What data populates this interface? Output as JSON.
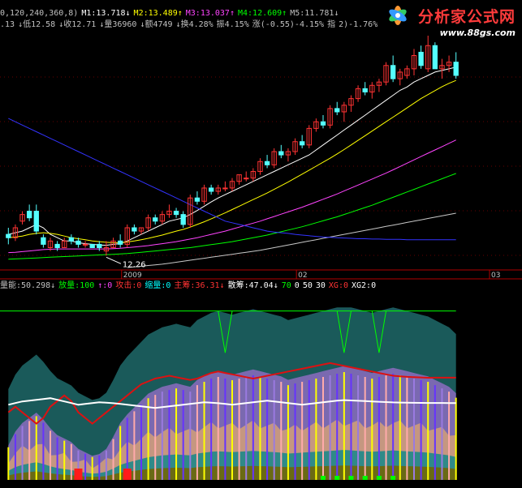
{
  "header": {
    "line1": [
      {
        "text": "0,120,240,360,8)",
        "color": "#c0c0c0"
      },
      {
        "text": "M1:13.718↓",
        "color": "#ffffff"
      },
      {
        "text": "M2:13.489↑",
        "color": "#ffff00"
      },
      {
        "text": "M3:13.037↑",
        "color": "#ff44ff"
      },
      {
        "text": "M4:12.609↑",
        "color": "#00ff00"
      },
      {
        "text": "M5:11.781↓",
        "color": "#c0c0c0"
      }
    ],
    "line2": [
      {
        "text": ".13",
        "color": "#c0c0c0"
      },
      {
        "text": "↓低12.58",
        "color": "#c0c0c0"
      },
      {
        "text": "↓收12.71",
        "color": "#c0c0c0"
      },
      {
        "text": "↓量36960",
        "color": "#c0c0c0"
      },
      {
        "text": "↓额4749",
        "color": "#c0c0c0"
      },
      {
        "text": "↓换4.28%",
        "color": "#c0c0c0"
      },
      {
        "text": "振4.15%",
        "color": "#c0c0c0"
      },
      {
        "text": "涨(-0.55)-4.15%",
        "color": "#c0c0c0"
      },
      {
        "text": "指",
        "color": "#c0c0c0"
      },
      {
        "text": "2)-1.76%",
        "color": "#c0c0c0"
      }
    ],
    "indicator_line": [
      {
        "text": "量能:50.298↓",
        "color": "#c0c0c0"
      },
      {
        "text": "放量:100",
        "color": "#00ff00"
      },
      {
        "text": "↑:0",
        "color": "#ff44ff"
      },
      {
        "text": "攻击:0",
        "color": "#ff3333"
      },
      {
        "text": "缩量:0",
        "color": "#00ffff"
      },
      {
        "text": "主筹:36.31↓",
        "color": "#ff3333"
      },
      {
        "text": "散筹:47.04↓",
        "color": "#ffffff"
      },
      {
        "text": "70",
        "color": "#00ff00"
      },
      {
        "text": "0",
        "color": "#ffffff"
      },
      {
        "text": "50",
        "color": "#ffffff"
      },
      {
        "text": "30",
        "color": "#ffffff"
      },
      {
        "text": "XG:0",
        "color": "#ff3333"
      },
      {
        "text": "XG2:0",
        "color": "#ffffff"
      }
    ]
  },
  "watermark": {
    "title": "分析家公式网",
    "url": "www.88gs.com"
  },
  "colors": {
    "up": "#ff3333",
    "down": "#54ffff",
    "ma1": "#ffffff",
    "ma2": "#ffff00",
    "ma3": "#ff44ff",
    "ma4": "#00ff00",
    "ma5": "#c8c8c8",
    "ma_long": "#3333ff",
    "axis": "#b00000",
    "grid": "#660000",
    "area_dark": "#1a5a5a",
    "area_purple": "#8c6cc0",
    "area_olive": "#6a6a14",
    "area_tan": "#d2a078",
    "area_teal": "#1e8888"
  },
  "chart_data": [
    {
      "type": "candlestick",
      "x_labels": [
        "2009",
        "02",
        "03"
      ],
      "annotations": [
        {
          "text": "12.26",
          "bar": 14
        }
      ],
      "ohlc": [
        [
          12.9,
          13.1,
          12.6,
          12.8
        ],
        [
          12.8,
          13.2,
          12.7,
          13.1
        ],
        [
          13.3,
          13.6,
          13.2,
          13.5
        ],
        [
          13.6,
          13.8,
          13.3,
          13.4
        ],
        [
          13.6,
          13.8,
          12.9,
          13.0
        ],
        [
          12.8,
          12.9,
          12.5,
          12.6
        ],
        [
          12.5,
          12.8,
          12.4,
          12.7
        ],
        [
          12.6,
          12.7,
          12.4,
          12.5
        ],
        [
          12.5,
          12.8,
          12.5,
          12.7
        ],
        [
          12.8,
          12.9,
          12.6,
          12.7
        ],
        [
          12.7,
          12.8,
          12.5,
          12.6
        ],
        [
          12.6,
          12.7,
          12.5,
          12.6
        ],
        [
          12.6,
          12.6,
          12.5,
          12.5
        ],
        [
          12.6,
          12.7,
          12.4,
          12.5
        ],
        [
          12.4,
          12.7,
          12.26,
          12.5
        ],
        [
          12.5,
          12.8,
          12.5,
          12.7
        ],
        [
          12.7,
          12.9,
          12.5,
          12.6
        ],
        [
          12.6,
          13.2,
          12.5,
          13.1
        ],
        [
          13.1,
          13.2,
          12.9,
          13.0
        ],
        [
          13.0,
          13.1,
          12.9,
          13.1
        ],
        [
          13.1,
          13.5,
          13.0,
          13.4
        ],
        [
          13.4,
          13.5,
          13.2,
          13.3
        ],
        [
          13.3,
          13.6,
          13.2,
          13.5
        ],
        [
          13.5,
          13.8,
          13.4,
          13.6
        ],
        [
          13.6,
          13.7,
          13.4,
          13.5
        ],
        [
          13.5,
          13.6,
          13.1,
          13.2
        ],
        [
          13.2,
          14.1,
          13.1,
          14.0
        ],
        [
          14.0,
          14.2,
          13.8,
          13.9
        ],
        [
          13.9,
          14.4,
          13.8,
          14.3
        ],
        [
          14.3,
          14.4,
          14.1,
          14.2
        ],
        [
          14.2,
          14.4,
          14.1,
          14.3
        ],
        [
          14.3,
          14.5,
          14.2,
          14.3
        ],
        [
          14.3,
          14.6,
          14.2,
          14.5
        ],
        [
          14.5,
          14.7,
          14.4,
          14.7
        ],
        [
          14.6,
          14.8,
          14.5,
          14.6
        ],
        [
          14.6,
          14.9,
          14.5,
          14.8
        ],
        [
          14.8,
          15.2,
          14.7,
          15.1
        ],
        [
          15.1,
          15.3,
          14.9,
          15.0
        ],
        [
          15.0,
          15.5,
          14.9,
          15.4
        ],
        [
          15.4,
          15.6,
          15.2,
          15.3
        ],
        [
          15.3,
          15.5,
          15.1,
          15.4
        ],
        [
          15.4,
          15.8,
          15.3,
          15.7
        ],
        [
          15.7,
          15.9,
          15.5,
          15.6
        ],
        [
          15.6,
          16.2,
          15.5,
          16.1
        ],
        [
          16.1,
          16.4,
          16.0,
          16.3
        ],
        [
          16.3,
          16.5,
          16.1,
          16.2
        ],
        [
          16.2,
          16.8,
          16.1,
          16.7
        ],
        [
          16.7,
          16.9,
          16.5,
          16.6
        ],
        [
          16.6,
          16.9,
          16.3,
          16.8
        ],
        [
          16.8,
          17.1,
          16.6,
          17.0
        ],
        [
          17.0,
          17.4,
          16.9,
          17.3
        ],
        [
          17.3,
          17.5,
          17.1,
          17.2
        ],
        [
          17.2,
          17.5,
          17.0,
          17.4
        ],
        [
          17.4,
          17.6,
          17.2,
          17.5
        ],
        [
          17.5,
          18.1,
          17.4,
          18.0
        ],
        [
          18.0,
          18.3,
          17.5,
          17.6
        ],
        [
          17.6,
          17.9,
          17.4,
          17.8
        ],
        [
          17.7,
          18.0,
          17.6,
          17.9
        ],
        [
          17.9,
          18.5,
          17.7,
          18.3
        ],
        [
          18.4,
          18.6,
          17.9,
          18.0
        ],
        [
          17.9,
          18.9,
          17.8,
          18.6
        ],
        [
          18.6,
          18.7,
          18.0,
          17.9
        ],
        [
          17.9,
          18.2,
          17.6,
          18.0
        ],
        [
          18.0,
          18.3,
          17.8,
          18.1
        ],
        [
          18.1,
          18.4,
          17.6,
          17.7
        ]
      ],
      "ma_lines": {
        "M1": [
          12.9,
          12.95,
          13.0,
          13.1,
          13.2,
          13.1,
          12.9,
          12.8,
          12.7,
          12.7,
          12.65,
          12.62,
          12.6,
          12.58,
          12.57,
          12.6,
          12.62,
          12.7,
          12.8,
          12.9,
          13.0,
          13.1,
          13.2,
          13.3,
          13.35,
          13.4,
          13.5,
          13.62,
          13.75,
          13.88,
          14.0,
          14.1,
          14.2,
          14.3,
          14.4,
          14.5,
          14.6,
          14.7,
          14.8,
          14.9,
          15.0,
          15.1,
          15.2,
          15.3,
          15.45,
          15.6,
          15.75,
          15.9,
          16.05,
          16.2,
          16.35,
          16.5,
          16.65,
          16.8,
          16.95,
          17.1,
          17.25,
          17.35,
          17.5,
          17.6,
          17.7,
          17.8,
          17.85,
          17.9,
          17.95
        ],
        "M2": [
          12.8,
          12.82,
          12.85,
          12.9,
          12.93,
          12.95,
          12.93,
          12.9,
          12.85,
          12.8,
          12.77,
          12.74,
          12.7,
          12.68,
          12.66,
          12.65,
          12.65,
          12.67,
          12.7,
          12.74,
          12.78,
          12.83,
          12.88,
          12.94,
          13.0,
          13.05,
          13.12,
          13.2,
          13.28,
          13.37,
          13.46,
          13.55,
          13.65,
          13.75,
          13.85,
          13.95,
          14.05,
          14.15,
          14.26,
          14.37,
          14.48,
          14.6,
          14.72,
          14.84,
          14.96,
          15.08,
          15.2,
          15.33,
          15.46,
          15.6,
          15.74,
          15.88,
          16.02,
          16.16,
          16.3,
          16.44,
          16.58,
          16.72,
          16.86,
          17.0,
          17.12,
          17.24,
          17.36,
          17.46,
          17.55
        ],
        "M3": [
          12.35,
          12.36,
          12.38,
          12.4,
          12.42,
          12.44,
          12.45,
          12.46,
          12.46,
          12.46,
          12.46,
          12.46,
          12.46,
          12.46,
          12.46,
          12.47,
          12.48,
          12.5,
          12.52,
          12.54,
          12.56,
          12.59,
          12.62,
          12.65,
          12.68,
          12.72,
          12.76,
          12.8,
          12.85,
          12.9,
          12.95,
          13.0,
          13.06,
          13.12,
          13.18,
          13.24,
          13.3,
          13.37,
          13.44,
          13.51,
          13.58,
          13.65,
          13.72,
          13.8,
          13.88,
          13.96,
          14.04,
          14.12,
          14.21,
          14.3,
          14.39,
          14.48,
          14.57,
          14.66,
          14.75,
          14.85,
          14.95,
          15.05,
          15.15,
          15.25,
          15.35,
          15.45,
          15.55,
          15.65,
          15.75
        ],
        "M4": [
          12.15,
          12.16,
          12.17,
          12.18,
          12.19,
          12.2,
          12.21,
          12.22,
          12.23,
          12.24,
          12.25,
          12.26,
          12.27,
          12.28,
          12.29,
          12.3,
          12.31,
          12.32,
          12.34,
          12.36,
          12.38,
          12.4,
          12.42,
          12.44,
          12.46,
          12.48,
          12.5,
          12.53,
          12.56,
          12.59,
          12.62,
          12.65,
          12.68,
          12.72,
          12.76,
          12.8,
          12.84,
          12.88,
          12.93,
          12.98,
          13.03,
          13.08,
          13.13,
          13.19,
          13.25,
          13.31,
          13.37,
          13.43,
          13.5,
          13.57,
          13.64,
          13.71,
          13.78,
          13.86,
          13.94,
          14.02,
          14.1,
          14.18,
          14.26,
          14.34,
          14.42,
          14.5,
          14.58,
          14.66,
          14.74
        ],
        "M5": [
          null,
          null,
          null,
          null,
          null,
          null,
          null,
          null,
          null,
          null,
          null,
          null,
          null,
          null,
          null,
          null,
          null,
          11.9,
          11.92,
          11.94,
          11.96,
          11.98,
          12.0,
          12.03,
          12.06,
          12.09,
          12.12,
          12.15,
          12.18,
          12.21,
          12.24,
          12.27,
          12.3,
          12.33,
          12.36,
          12.39,
          12.42,
          12.46,
          12.5,
          12.54,
          12.58,
          12.62,
          12.66,
          12.7,
          12.74,
          12.78,
          12.82,
          12.86,
          12.9,
          12.94,
          12.98,
          13.02,
          13.06,
          13.1,
          13.14,
          13.18,
          13.22,
          13.26,
          13.3,
          13.34,
          13.38,
          13.42,
          13.46,
          13.5,
          13.54
        ],
        "long": [
          16.4,
          16.3,
          16.2,
          16.1,
          16.0,
          15.9,
          15.8,
          15.7,
          15.6,
          15.5,
          15.4,
          15.3,
          15.2,
          15.1,
          15.0,
          14.9,
          14.8,
          14.7,
          14.6,
          14.5,
          14.4,
          14.3,
          14.2,
          14.1,
          14.0,
          13.9,
          13.8,
          13.7,
          13.6,
          13.5,
          13.4,
          13.3,
          13.25,
          13.2,
          13.15,
          13.1,
          13.05,
          13.0,
          12.97,
          12.95,
          12.93,
          12.9,
          12.88,
          12.86,
          12.84,
          12.82,
          12.81,
          12.8,
          12.79,
          12.78,
          12.77,
          12.77,
          12.76,
          12.76,
          12.75,
          12.75,
          12.75,
          12.74,
          12.74,
          12.74,
          12.74,
          12.74,
          12.74,
          12.74,
          12.74
        ]
      }
    },
    {
      "type": "indicator",
      "series": [
        {
          "name": "量能",
          "values": [
            20,
            28,
            33,
            36,
            39,
            35,
            30,
            26,
            24,
            22,
            18,
            16,
            14,
            15,
            18,
            25,
            33,
            38,
            42,
            46,
            50,
            52,
            54,
            55,
            56,
            55,
            54,
            58,
            60,
            62,
            63,
            62,
            61,
            62,
            63,
            64,
            63,
            62,
            61,
            60,
            58,
            59,
            60,
            61,
            62,
            63,
            64,
            65,
            66,
            65,
            64,
            63,
            62,
            63,
            64,
            65,
            64,
            63,
            62,
            61,
            60,
            58,
            56,
            54,
            50.298
          ]
        },
        {
          "name": "主筹",
          "values": [
            24,
            26,
            24,
            22,
            20,
            22,
            26,
            28,
            30,
            28,
            24,
            22,
            20,
            22,
            24,
            26,
            28,
            30,
            32,
            34,
            35,
            36,
            36.5,
            37,
            36.5,
            36,
            35.5,
            36,
            37,
            38,
            38.5,
            38,
            37.5,
            37,
            36.5,
            36,
            36.5,
            37,
            37.5,
            38,
            38.5,
            39,
            39.5,
            40,
            40.5,
            41,
            41.5,
            41,
            40.5,
            40,
            39.5,
            39,
            38.5,
            38,
            37.5,
            37,
            36.8,
            36.6,
            36.5,
            36.4,
            36.3,
            36.31,
            36.31,
            36.31,
            36.31
          ]
        },
        {
          "name": "散筹",
          "values": [
            46,
            47,
            48,
            48.5,
            49,
            49.5,
            50,
            49,
            48,
            47,
            46,
            46.5,
            47,
            47.5,
            47.2,
            46.9,
            46.5,
            46,
            45.5,
            45,
            44.5,
            44,
            44.5,
            45,
            45.5,
            46,
            46.5,
            47,
            47.5,
            47.2,
            46.9,
            46.5,
            46,
            46.5,
            47,
            47.5,
            48,
            48.5,
            48,
            47.5,
            47,
            46.5,
            46,
            46.5,
            47,
            47.5,
            48,
            48.5,
            48.8,
            48.6,
            48.4,
            48.2,
            48,
            47.8,
            47.6,
            47.4,
            47.3,
            47.2,
            47.15,
            47.1,
            47.08,
            47.06,
            47.05,
            47.04,
            47.04
          ]
        }
      ],
      "levels": [
        0,
        30,
        50,
        70,
        100
      ],
      "ylim": [
        0,
        100
      ]
    }
  ]
}
